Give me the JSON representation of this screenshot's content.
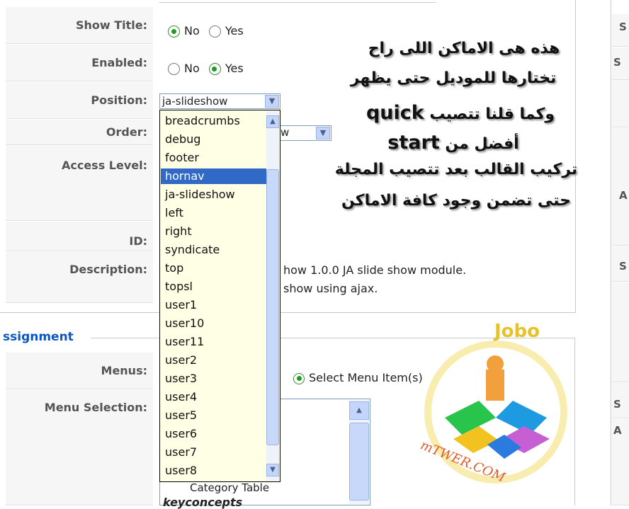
{
  "form": {
    "show_title": {
      "label": "Show Title:",
      "options": [
        "No",
        "Yes"
      ],
      "selected": "No"
    },
    "enabled": {
      "label": "Enabled:",
      "options": [
        "No",
        "Yes"
      ],
      "selected": "Yes"
    },
    "position": {
      "label": "Position:",
      "value": "ja-slideshow"
    },
    "order": {
      "label": "Order:"
    },
    "access_level": {
      "label": "Access Level:"
    },
    "id": {
      "label": "ID:"
    },
    "description": {
      "label": "Description:",
      "line1": "how 1.0.0 JA slide show module.",
      "line2": "show using ajax."
    }
  },
  "position_dropdown": {
    "options": [
      "breadcrumbs",
      "debug",
      "footer",
      "hornav",
      "ja-slideshow",
      "left",
      "right",
      "syndicate",
      "top",
      "topsl",
      "user1",
      "user10",
      "user11",
      "user2",
      "user3",
      "user4",
      "user5",
      "user6",
      "user7",
      "user8"
    ],
    "highlighted": "hornav"
  },
  "assignment": {
    "section_title": "ssignment",
    "menus_label": "Menus:",
    "menus_option": "Select Menu Item(s)",
    "menu_selection_label": "Menu Selection:",
    "list_items": [
      "Category Table",
      "keyconcepts"
    ]
  },
  "annotation": {
    "line1": "هذه هى الاماكن اللى راح",
    "line2": "تختارها للموديل حتى يظهر",
    "line3_ar": "وكما قلنا تتصيب",
    "line3_en": "quick",
    "line4_en": "start",
    "line4_ar": "أفضل من",
    "line5": "تركيب القالب بعد تتصيب المجلة",
    "line6": "حتى تضمن وجود كافة الاماكن"
  },
  "watermark": {
    "top_text": "Jobo",
    "bottom_text": "mTWER.COM"
  },
  "right_panel_letters": [
    "S",
    "S",
    "A",
    "S",
    "S",
    "A"
  ]
}
